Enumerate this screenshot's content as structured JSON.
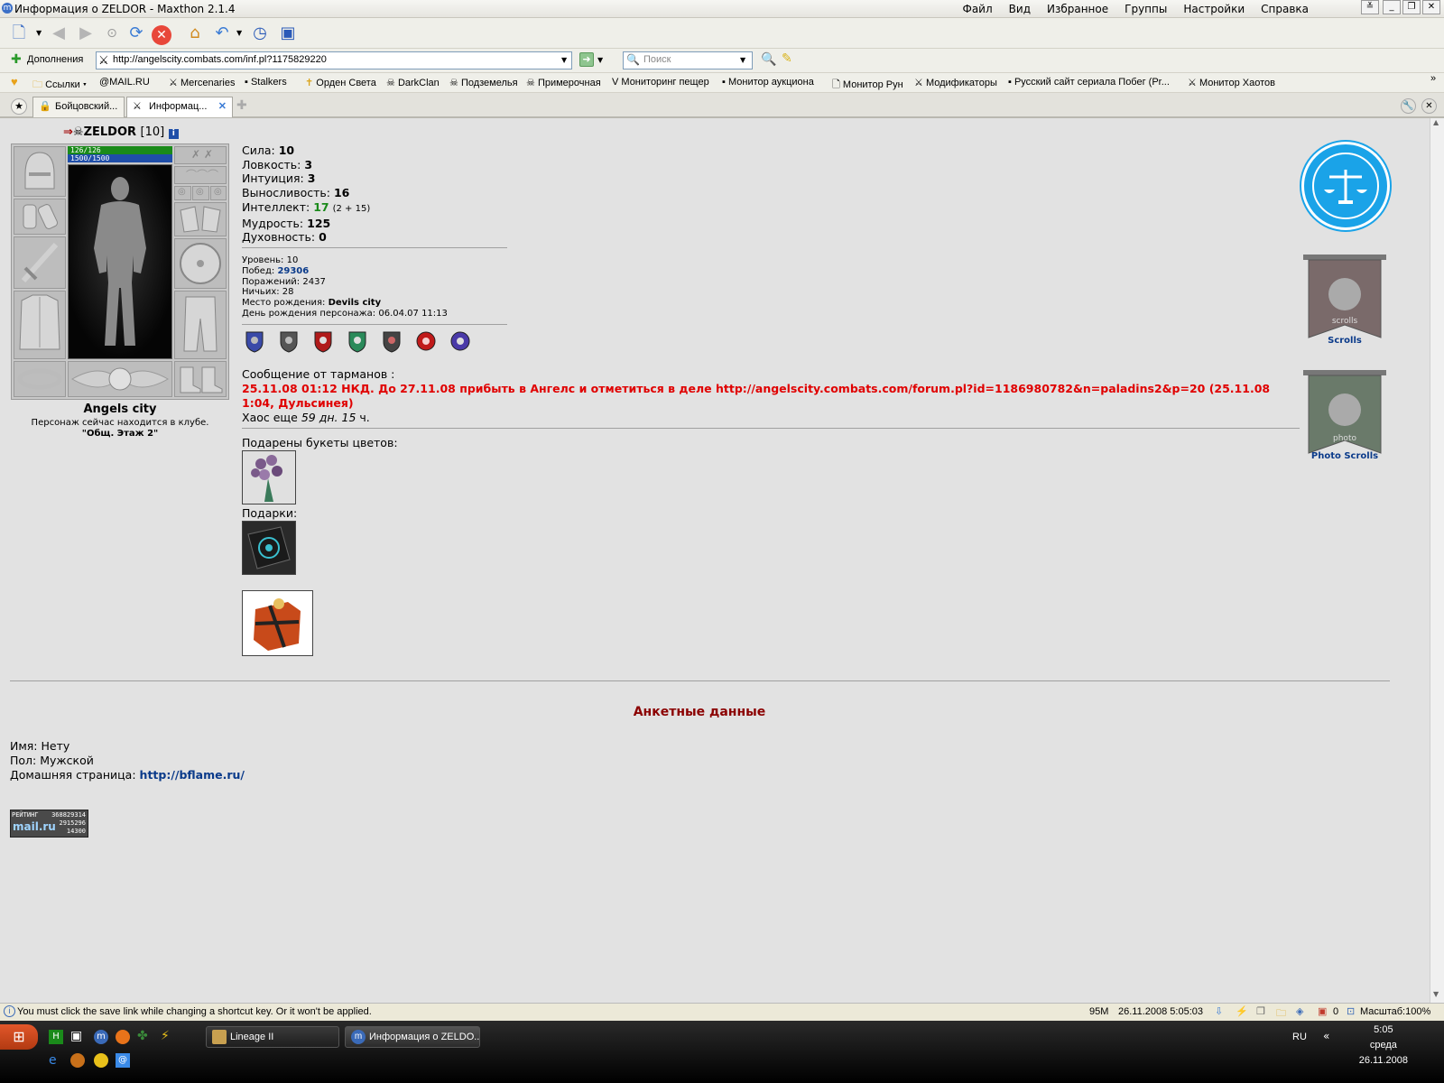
{
  "window": {
    "title": "Информация о ZELDOR - Maxthon 2.1.4",
    "menu": [
      "Файл",
      "Вид",
      "Избранное",
      "Группы",
      "Настройки",
      "Справка"
    ]
  },
  "addons_label": "Дополнения",
  "address": {
    "url": "http://angelscity.combats.com/inf.pl?1175829220"
  },
  "search": {
    "placeholder": "Поиск"
  },
  "links": [
    "Ссылки",
    "@MAIL.RU",
    "Mercenaries",
    "Stalkers",
    "Орден Света",
    "DarkClan",
    "Подземелья",
    "Примерочная",
    "Мониторинг пещер",
    "Монитор аукциона",
    "Монитор Рун",
    "Модификаторы",
    "Русский сайт сериала Побег (Pr...",
    "Монитор Хаотов"
  ],
  "tabs": [
    {
      "label": "Бойцовский..."
    },
    {
      "label": "Информац..."
    }
  ],
  "character": {
    "name": "ZELDOR",
    "level_text": "[10]",
    "hp": "126/126",
    "mana": "1500/1500",
    "city": "Angels city",
    "location_line1": "Персонаж сейчас находится в клубе.",
    "location_line2": "\"Общ. Этаж 2\""
  },
  "stats": [
    {
      "label": "Сила:",
      "value": "10"
    },
    {
      "label": "Ловкость:",
      "value": "3"
    },
    {
      "label": "Интуиция:",
      "value": "3"
    },
    {
      "label": "Выносливость:",
      "value": "16"
    },
    {
      "label": "Интеллект:",
      "value": "17",
      "extra": "(2 + 15)"
    },
    {
      "label": "Мудрость:",
      "value": "125"
    },
    {
      "label": "Духовность:",
      "value": "0"
    }
  ],
  "info": {
    "level": "Уровень: 10",
    "wins_label": "Побед:",
    "wins": "29306",
    "losses": "Поражений: 2437",
    "draws": "Ничьих: 28",
    "birthplace_label": "Место рождения:",
    "birthplace": "Devils city",
    "birthday": "День рождения персонажа: 06.04.07 11:13"
  },
  "message": {
    "header": "Сообщение от тарманов :",
    "text": "25.11.08 01:12 НКД. До 27.11.08 прибыть в Ангелс и отметиться в деле http://angelscity.combats.com/forum.pl?id=1186980782&n=paladins2&p=20 (25.11.08 1:04, Дульсинея)",
    "chaos_prefix": "Хаос еще",
    "chaos_value": "59 дн. 15",
    "chaos_suffix": "ч."
  },
  "flowers_label": "Подарены букеты цветов:",
  "gifts_label": "Подарки:",
  "right": {
    "scrolls": "Scrolls",
    "photo_scrolls": "Photo Scrolls"
  },
  "anketa": {
    "title": "Анкетные данные",
    "name": "Имя: Нету",
    "gender": "Пол: Мужской",
    "homepage_label": "Домашняя страница:",
    "homepage": "http://bflame.ru/"
  },
  "counter": {
    "label": "РЕЙТИНГ",
    "n1": "368829314",
    "n2": "2915296",
    "n3": "14300",
    "brand": "mail.ru"
  },
  "statusbar": {
    "message": "You must click the save link while changing a shortcut key. Or it won't be applied.",
    "memory": "95M",
    "datetime": "26.11.2008 5:05:03",
    "count": "0",
    "zoom": "Масштаб:100%"
  },
  "taskbar": {
    "buttons": [
      "Lineage II",
      "Информация о ZELDO..."
    ],
    "lang": "RU",
    "time": "5:05",
    "day": "среда",
    "date": "26.11.2008"
  }
}
